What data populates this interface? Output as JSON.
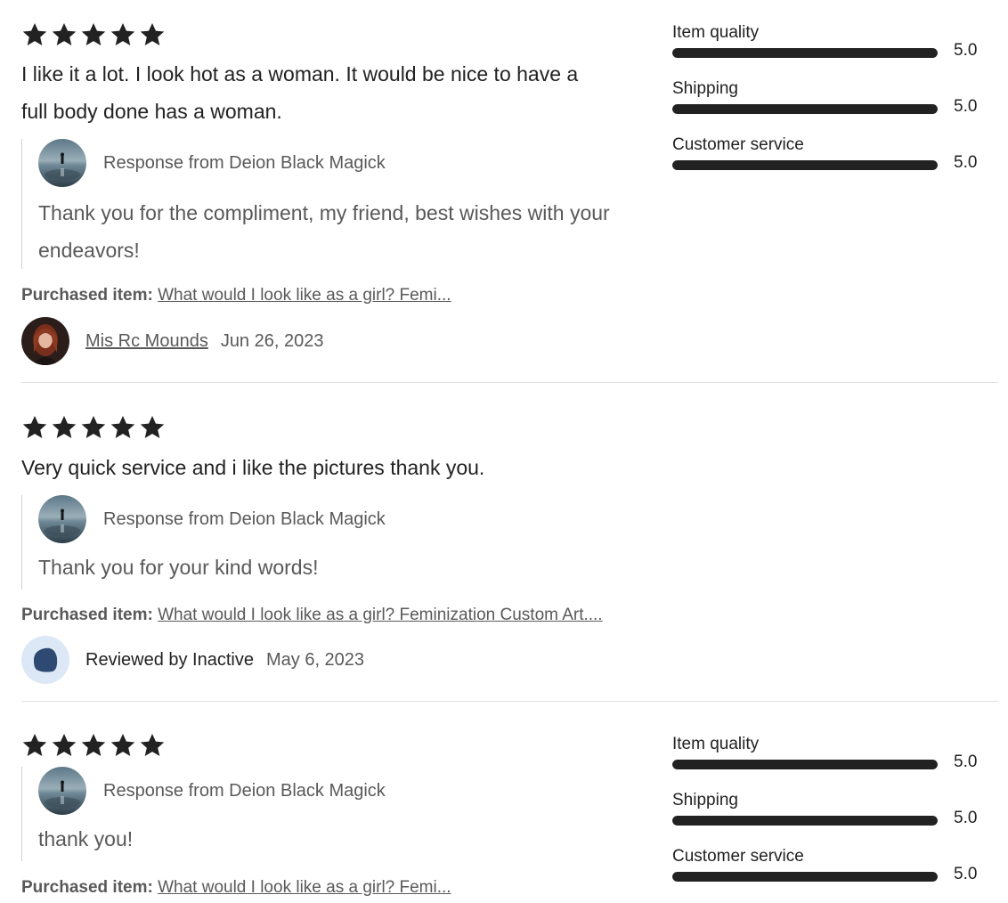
{
  "reviews": [
    {
      "rating": 5,
      "text": "I like it a lot. I look hot as a woman. It would be nice to have a full body done has a woman.",
      "response_from": "Response from Deion Black Magick",
      "response_text": "Thank you for the compliment, my friend, best wishes with your endeavors!",
      "purchased_label": "Purchased item:",
      "purchased_item": "What would I look like as a girl? Femi...",
      "reviewer": "Mis Rc Mounds",
      "date": "Jun 26, 2023",
      "ratings": [
        {
          "label": "Item quality",
          "value": "5.0",
          "fraction": 1.0
        },
        {
          "label": "Shipping",
          "value": "5.0",
          "fraction": 1.0
        },
        {
          "label": "Customer service",
          "value": "5.0",
          "fraction": 1.0
        }
      ]
    },
    {
      "rating": 5,
      "text": "Very quick service and i like the pictures thank you.",
      "response_from": "Response from Deion Black Magick",
      "response_text": "Thank you for your kind words!",
      "purchased_label": "Purchased item:",
      "purchased_item": "What would I look like as a girl? Feminization Custom Art....",
      "reviewer": "Reviewed by Inactive",
      "date": "May 6, 2023"
    },
    {
      "rating": 5,
      "response_from": "Response from Deion Black Magick",
      "response_text": "thank you!",
      "purchased_label": "Purchased item:",
      "purchased_item": "What would I look like as a girl? Femi...",
      "ratings": [
        {
          "label": "Item quality",
          "value": "5.0",
          "fraction": 1.0
        },
        {
          "label": "Shipping",
          "value": "5.0",
          "fraction": 1.0
        },
        {
          "label": "Customer service",
          "value": "5.0",
          "fraction": 1.0
        }
      ]
    }
  ],
  "colors": {
    "star": "#222222",
    "bar_fill": "#222222",
    "bar_track": "#e0e0e0",
    "muted_text": "#595959",
    "divider": "#e1e1e1",
    "inactive_avatar_bg": "#dce8f5",
    "inactive_avatar_shape": "#2f4a72"
  },
  "icons": {
    "star": "star-icon",
    "shop_avatar": "shop-avatar-image",
    "inactive_avatar": "inactive-user-icon"
  }
}
